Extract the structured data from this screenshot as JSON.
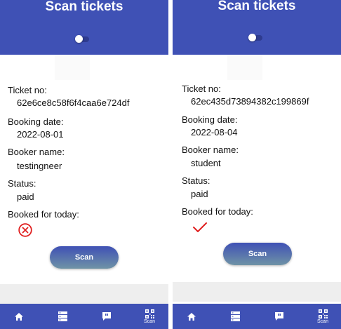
{
  "colors": {
    "primary": "#3f51b5",
    "error_red": "#e02020",
    "scan_gradient_end": "#6f93a6"
  },
  "screens": [
    {
      "title": "Scan tickets",
      "ticket_label": "Ticket no:",
      "ticket_value": "62e6ce8c58f6f4caa6e724df",
      "date_label": "Booking date:",
      "date_value": "2022-08-01",
      "booker_label": "Booker name:",
      "booker_value": "testingneer",
      "status_label": "Status:",
      "status_value": "paid",
      "today_label": "Booked for today:",
      "today_icon": "cross-circle-icon",
      "scan_label": "Scan",
      "nav": [
        "home-icon",
        "list-icon",
        "chat-icon",
        "qr-code-icon"
      ],
      "nav_active_label": "Scan"
    },
    {
      "title": "Scan tickets",
      "ticket_label": "Ticket no:",
      "ticket_value": "62ec435d73894382c199869f",
      "date_label": "Booking date:",
      "date_value": "2022-08-04",
      "booker_label": "Booker name:",
      "booker_value": "student",
      "status_label": "Status:",
      "status_value": "paid",
      "today_label": "Booked for today:",
      "today_icon": "checkmark-icon",
      "scan_label": "Scan",
      "nav": [
        "home-icon",
        "list-icon",
        "chat-icon",
        "qr-code-icon"
      ],
      "nav_active_label": "Scan"
    }
  ]
}
